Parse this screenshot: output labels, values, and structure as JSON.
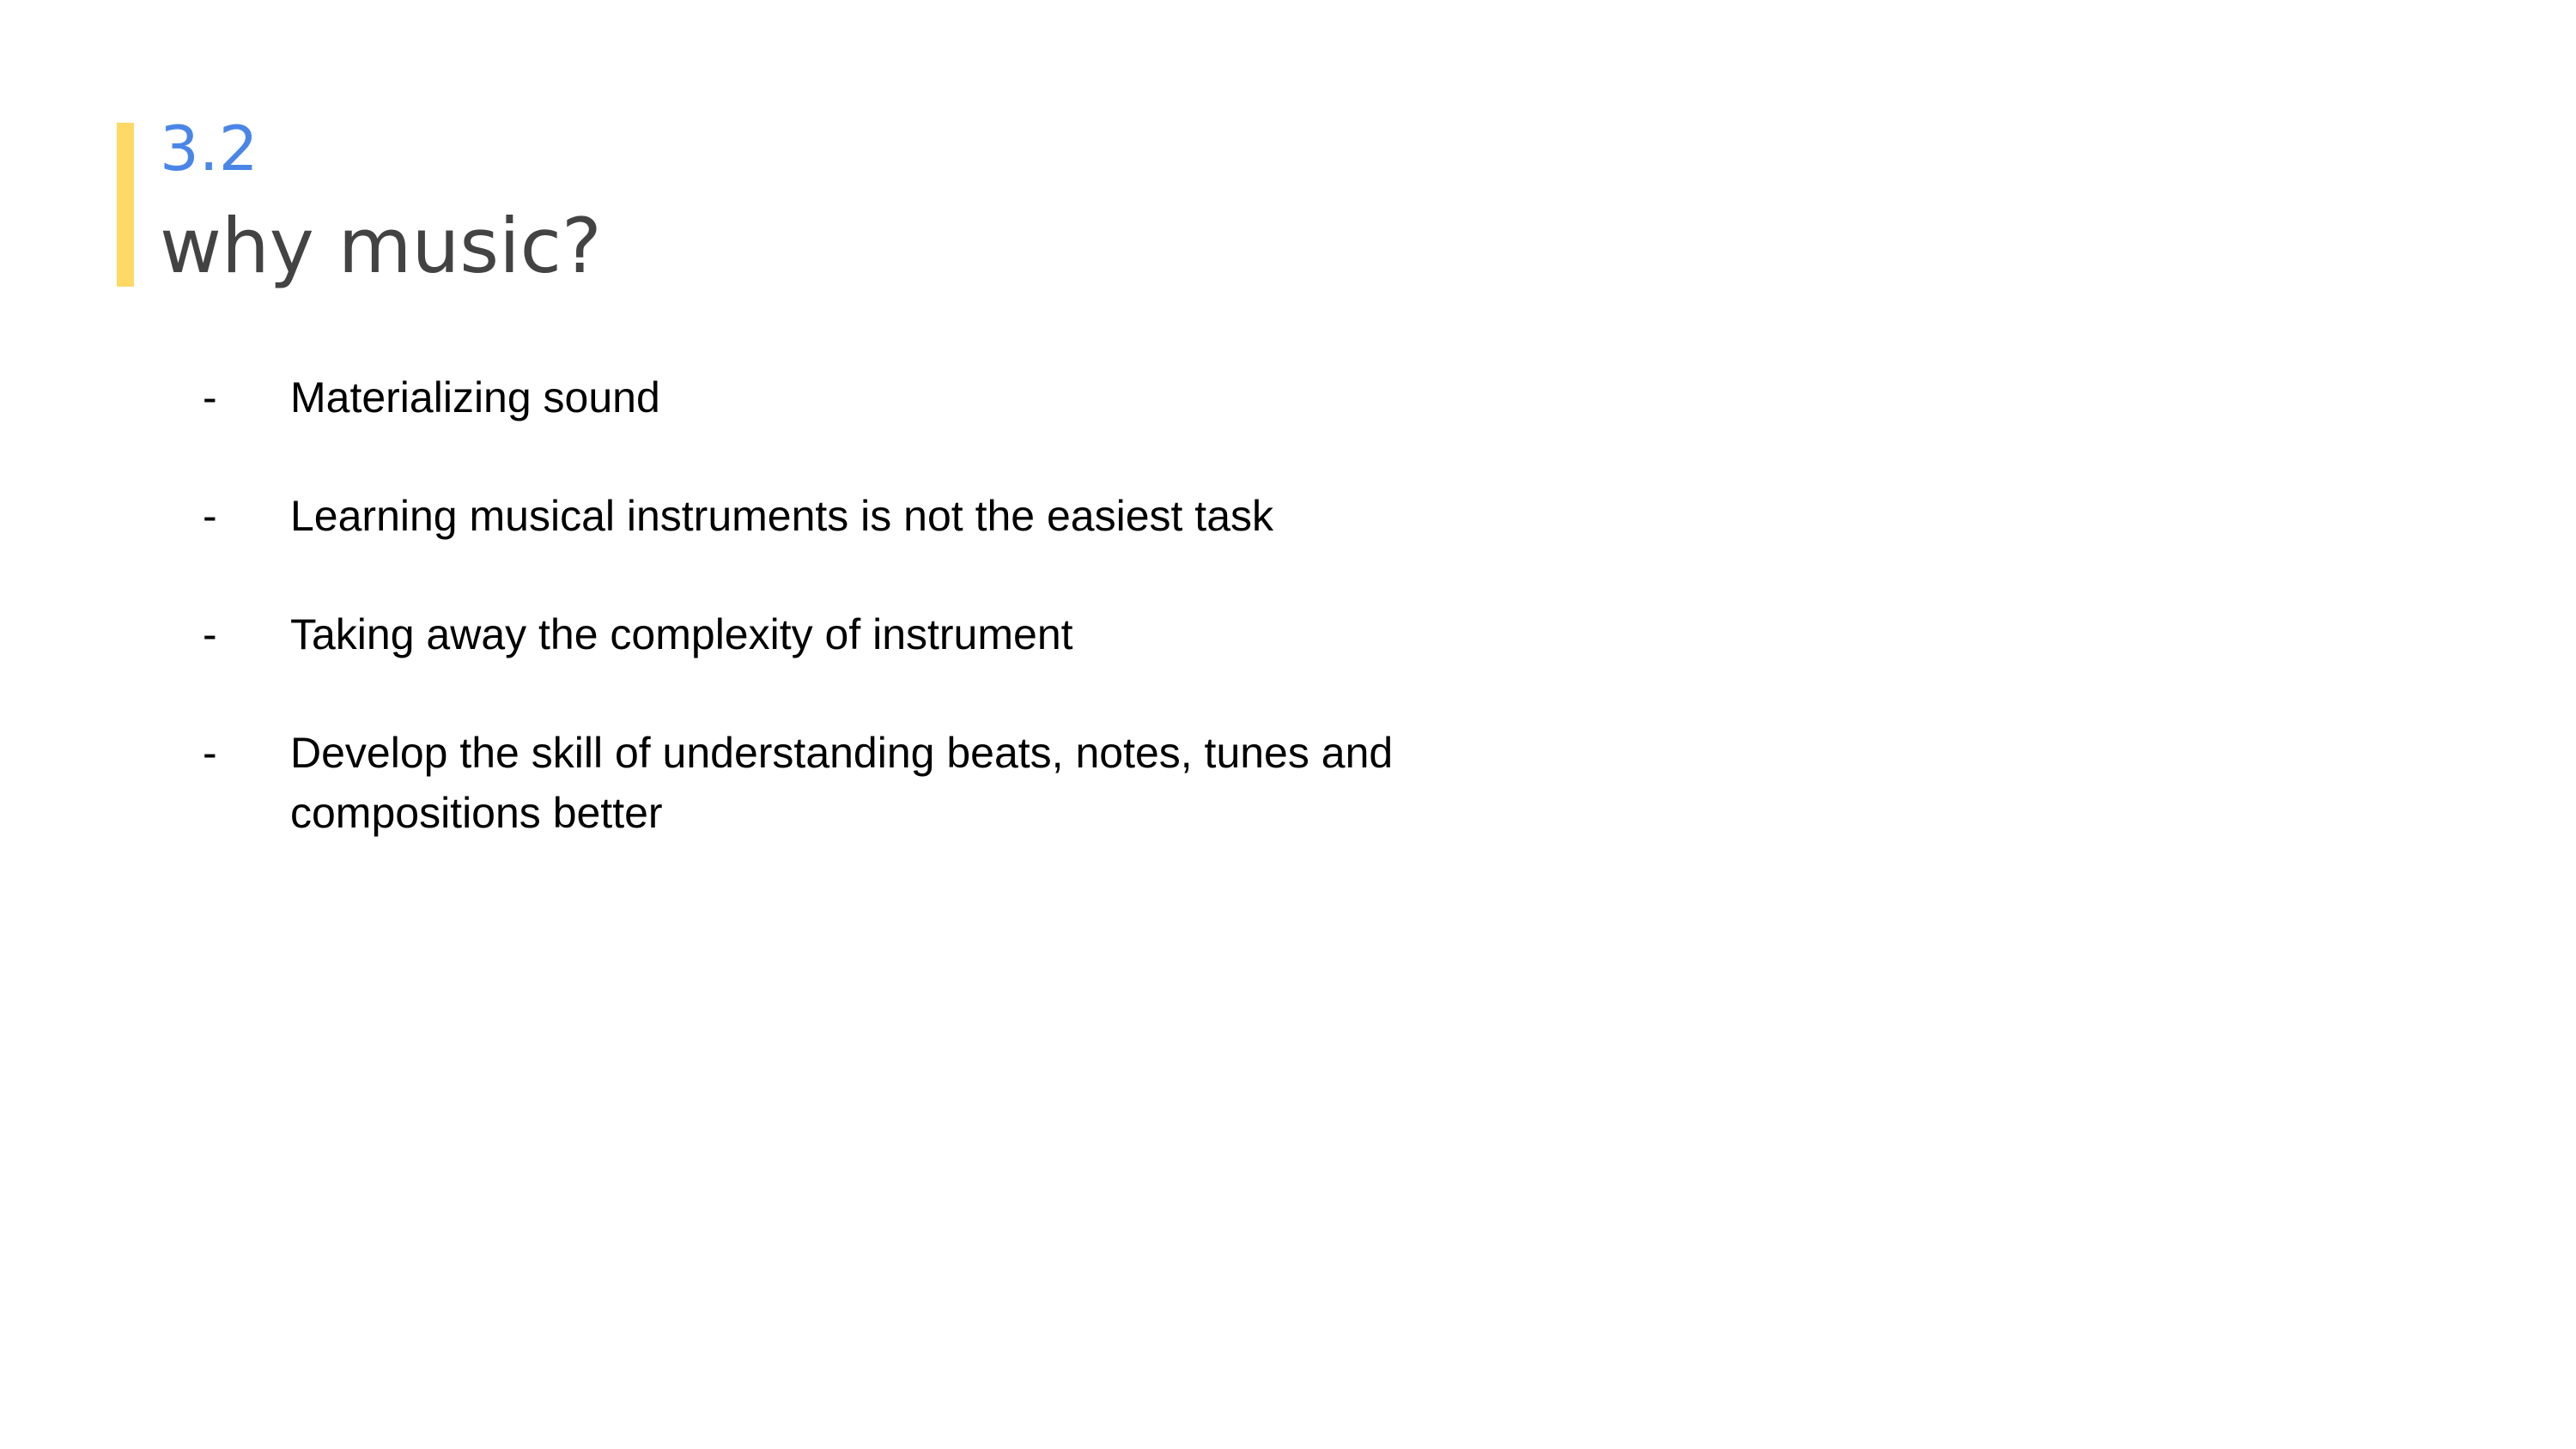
{
  "slide": {
    "section_number": "3.2",
    "title": "why music?",
    "bullets": [
      {
        "marker": "-",
        "text": "Materializing sound"
      },
      {
        "marker": "-",
        "text": "Learning musical instruments is not the easiest task"
      },
      {
        "marker": "-",
        "text": "Taking away the complexity of instrument"
      },
      {
        "marker": "-",
        "text": "Develop the skill of understanding beats, notes, tunes and compositions better"
      }
    ]
  },
  "colors": {
    "background": "#ffffff",
    "accent_bar": "#FFD966",
    "section_number": "#4A86E8",
    "title": "#434343",
    "body_text": "#000000"
  }
}
